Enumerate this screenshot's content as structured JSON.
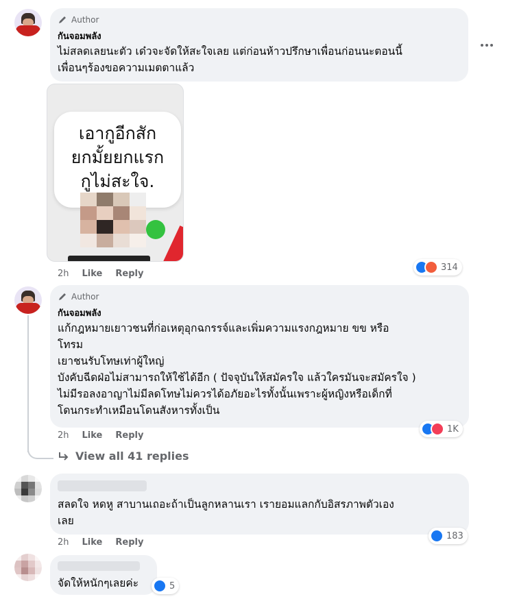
{
  "comments": [
    {
      "badge": "Author",
      "name": "กันจอมพลัง",
      "lines": [
        "ไม่สลดเลยนะตัว เด๋วจะจัดให้สะใจเลย แต่ก่อนห้าวปรึกษาเพื่อนก่อนนะตอนนี้",
        "เพื่อนๆร้องขอความเมตตาแล้ว"
      ],
      "image_text": [
        "เอากูอีกสัก",
        "ยกมั้ยยกแรก",
        "กูไม่สะใจ."
      ],
      "time": "2h",
      "like": "Like",
      "reply": "Reply",
      "reaction_count": "314",
      "reaction_icons": [
        "like-icon",
        "angry-icon"
      ]
    },
    {
      "badge": "Author",
      "name": "กันจอมพลัง",
      "lines": [
        "แก้กฎหมายเยาวชนที่ก่อเหตุอุกฉกรรจ์และเพิ่มความแรงกฎหมาย ขข หรือ",
        "โทรม",
        "เยาชนรับโทษเท่าผู้ใหญ่",
        "บังคับฉีดฝ่อไม่สามารถให้ใช้ได้อีก ( ปัจจุบันให้สมัครใจ แล้วใครมันจะสมัครใจ )",
        "ไม่มีรอลงอาญาไม่มีลดโทษไม่ควรได้อภัยอะไรทั้งนั้นเพราะผู้หญิงหรือเด็กที่",
        "โดนกระทำเหมือนโดนสังหารทั้งเป็น"
      ],
      "time": "2h",
      "like": "Like",
      "reply": "Reply",
      "reaction_count": "1K",
      "reaction_icons": [
        "like-icon",
        "love-icon"
      ]
    },
    {
      "lines": [
        "สลดใจ หดหู สาบานเถอะถ้าเป็นลูกหลานเรา เรายอมแลกกับอิสรภาพตัวเอง",
        "เลย"
      ],
      "time": "2h",
      "like": "Like",
      "reply": "Reply",
      "reaction_count": "183",
      "reaction_icons": [
        "like-icon"
      ]
    },
    {
      "lines": [
        "จัดให้หนักๆเลยค่ะ"
      ],
      "reaction_count": "5",
      "reaction_icons": [
        "like-icon"
      ]
    }
  ],
  "view_replies": "View all 41 replies",
  "colors": {
    "bubble": "#f0f2f5",
    "like_blue": "#1877f2",
    "angry": "#f25d3c",
    "love": "#f33e58",
    "meta_gray": "#65676b"
  }
}
